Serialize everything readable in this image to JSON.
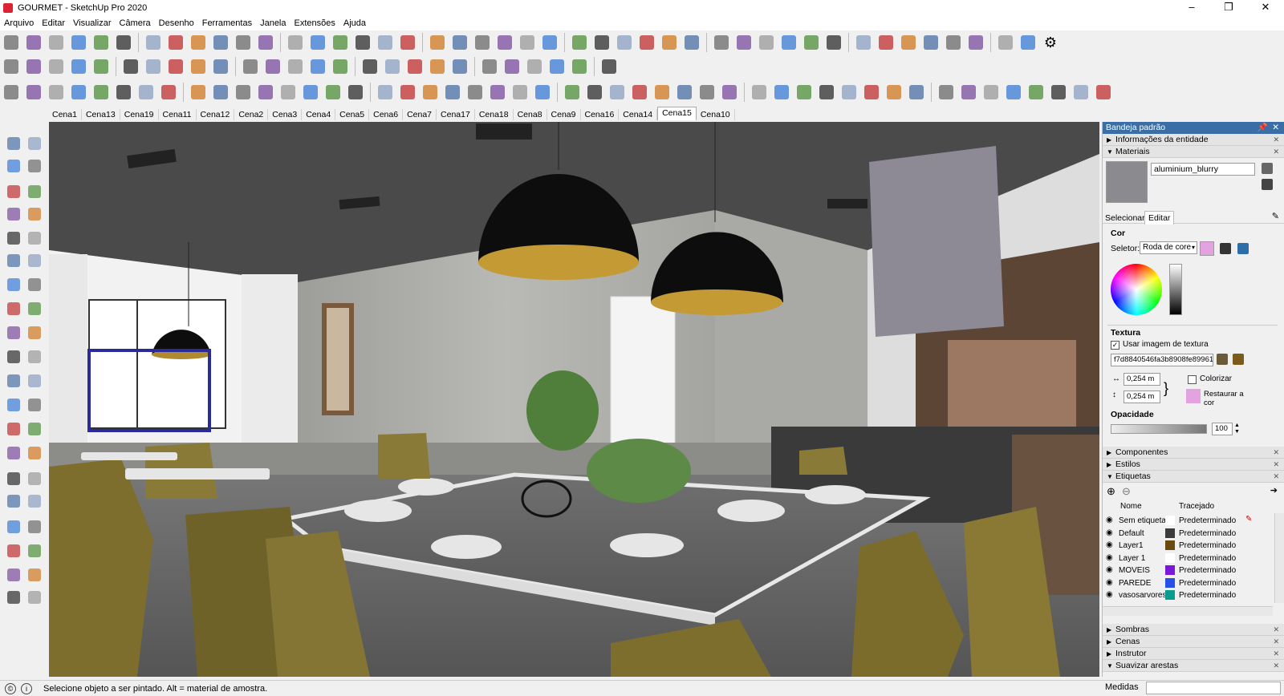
{
  "window": {
    "title": "GOURMET - SketchUp Pro 2020",
    "controls": [
      "–",
      "❐",
      "✕"
    ]
  },
  "menu": [
    "Arquivo",
    "Editar",
    "Visualizar",
    "Câmera",
    "Desenho",
    "Ferramentas",
    "Janela",
    "Extensões",
    "Ajuda"
  ],
  "scenes": [
    "Cena1",
    "Cena13",
    "Cena19",
    "Cena11",
    "Cena12",
    "Cena2",
    "Cena3",
    "Cena4",
    "Cena5",
    "Cena6",
    "Cena7",
    "Cena17",
    "Cena18",
    "Cena8",
    "Cena9",
    "Cena16",
    "Cena14",
    "Cena15",
    "Cena10"
  ],
  "active_scene": "Cena15",
  "tray": {
    "title": "Bandeja padrão",
    "panels": {
      "entity_info": "Informações da entidade",
      "materials": "Materiais",
      "components": "Componentes",
      "styles": "Estilos",
      "tags": "Etiquetas",
      "shadows": "Sombras",
      "scenes": "Cenas",
      "instructor": "Instrutor",
      "soften": "Suavizar arestas"
    },
    "materials": {
      "name": "aluminium_blurry",
      "tab_select": "Selecionar",
      "tab_edit": "Editar",
      "color_heading": "Cor",
      "selector_label": "Seletor:",
      "selector_value": "Roda de core",
      "texture_heading": "Textura",
      "use_texture_label": "Usar imagem de textura",
      "texture_file": "f7d8840546fa3b8908fe89961",
      "width": "0,254 m",
      "height": "0,254 m",
      "colorize_label": "Colorizar",
      "reset_color_label": "Restaurar a cor",
      "opacity_heading": "Opacidade",
      "opacity_value": "100",
      "swatch_color": "#e2a3e0"
    },
    "tags": {
      "col_name": "Nome",
      "col_dash": "Tracejado",
      "rows": [
        {
          "name": "Sem etiquetas",
          "color": "#ffffff",
          "dash": "Predeterminado"
        },
        {
          "name": "Default",
          "color": "#3c3c3c",
          "dash": "Predeterminado"
        },
        {
          "name": "Layer1",
          "color": "#6b4a12",
          "dash": "Predeterminado"
        },
        {
          "name": "Layer 1",
          "color": "#ffffff",
          "dash": "Predeterminado"
        },
        {
          "name": "MOVEIS",
          "color": "#7b18d8",
          "dash": "Predeterminado"
        },
        {
          "name": "PAREDE",
          "color": "#2850e6",
          "dash": "Predeterminado"
        },
        {
          "name": "vasosarvores",
          "color": "#0a9c8c",
          "dash": "Predeterminado"
        }
      ]
    }
  },
  "status": {
    "message": "Selecione objeto a ser pintado. Alt = material de amostra.",
    "measures_label": "Medidas"
  }
}
